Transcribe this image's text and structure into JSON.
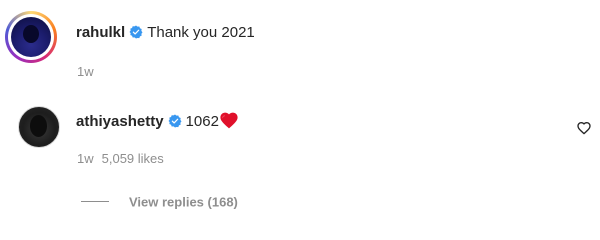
{
  "caption": {
    "username": "rahulkl",
    "text": "Thank you 2021",
    "time": "1w"
  },
  "comment": {
    "username": "athiyashetty",
    "text": "1062",
    "emoji": "red-heart",
    "time": "1w",
    "likes": "5,059 likes",
    "view_replies": "View replies (168)"
  },
  "colors": {
    "verified_badge": "#3897f0",
    "muted_text": "#8e8e8e",
    "heart": "#e0102b"
  },
  "icons": {
    "verified": "verified-badge-icon",
    "like": "heart-outline-icon"
  }
}
